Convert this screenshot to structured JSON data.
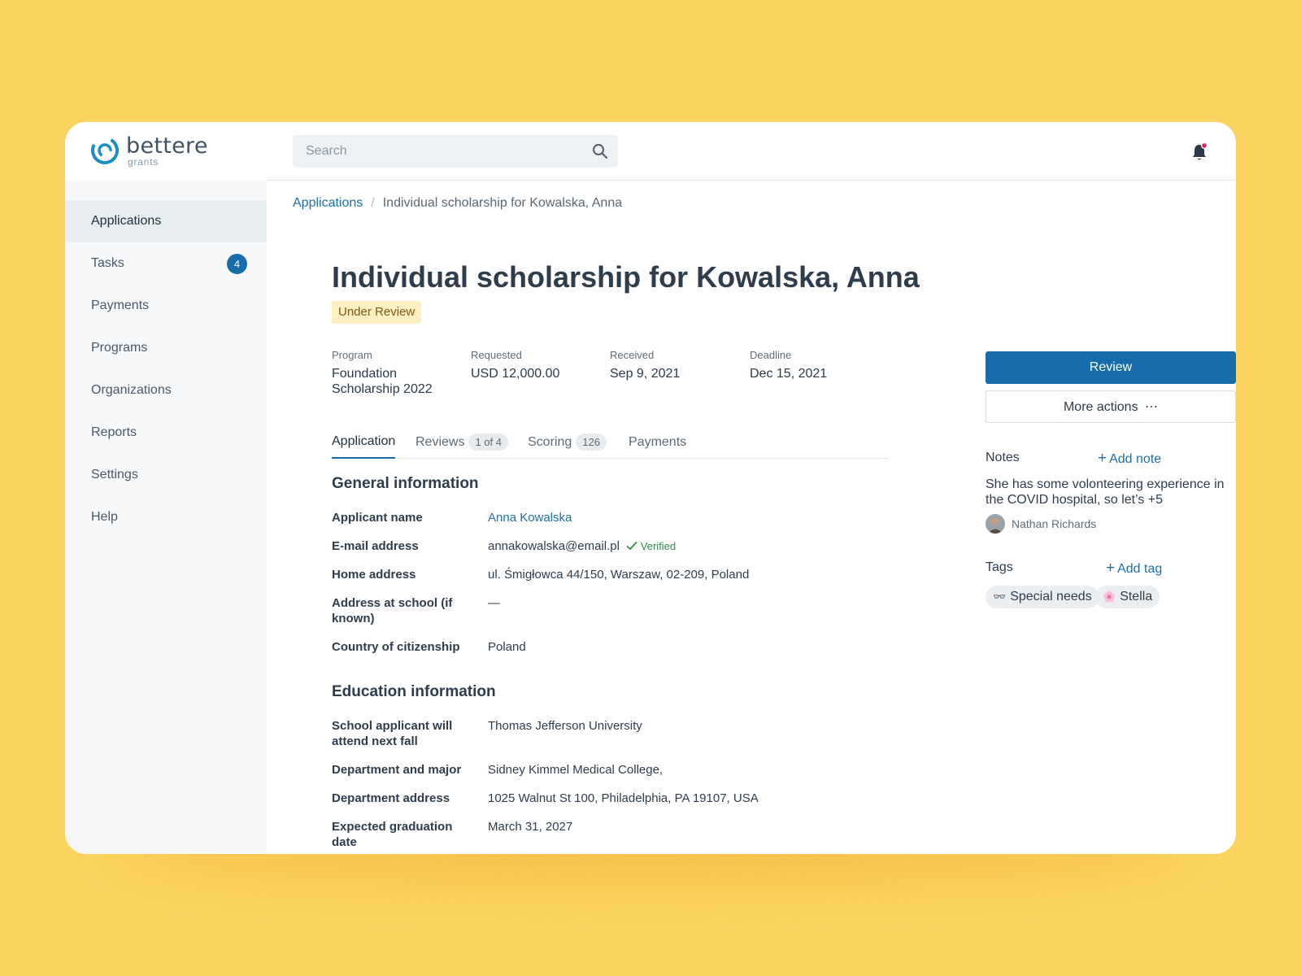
{
  "brand": {
    "name": "bettere",
    "tagline": "grants",
    "color": "#176cab"
  },
  "search": {
    "placeholder": "Search"
  },
  "sidebar": {
    "items": [
      {
        "label": "Applications",
        "active": true
      },
      {
        "label": "Tasks",
        "badge": "4"
      },
      {
        "label": "Payments"
      },
      {
        "label": "Programs"
      },
      {
        "label": "Organizations"
      },
      {
        "label": "Reports"
      },
      {
        "label": "Settings"
      },
      {
        "label": "Help"
      }
    ]
  },
  "breadcrumb": {
    "parent": "Applications",
    "separator": "/",
    "current": "Individual scholarship for Kowalska, Anna"
  },
  "header": {
    "title": "Individual scholarship for Kowalska, Anna",
    "status": "Under Review"
  },
  "meta": [
    {
      "label": "Program",
      "value": "Foundation Scholarship 2022"
    },
    {
      "label": "Requested",
      "value": "USD 12,000.00"
    },
    {
      "label": "Received",
      "value": "Sep 9, 2021"
    },
    {
      "label": "Deadline",
      "value": "Dec 15, 2021"
    }
  ],
  "tabs": [
    {
      "label": "Application",
      "active": true
    },
    {
      "label": "Reviews",
      "count": "1 of 4"
    },
    {
      "label": "Scoring",
      "count": "126"
    },
    {
      "label": "Payments"
    }
  ],
  "general": {
    "title": "General information",
    "fields": [
      {
        "label": "Applicant name",
        "value": "Anna Kowalska"
      },
      {
        "label": "E-mail address",
        "value": "annakowalska@email.pl",
        "verified": "Verified"
      },
      {
        "label": "Home address",
        "value": "ul. Śmigłowca 44/150, Warszaw, 02-209, Poland"
      },
      {
        "label": "Address at school (if known)",
        "value": "—"
      },
      {
        "label": "Country of citizenship",
        "value": "Poland"
      }
    ]
  },
  "education": {
    "title": "Education information",
    "fields": [
      {
        "label": "School applicant will attend next fall",
        "value": "Thomas Jefferson University"
      },
      {
        "label": "Department and major",
        "value": "Sidney Kimmel Medical College,"
      },
      {
        "label": "Department address",
        "value": "1025 Walnut St 100, Philadelphia, PA 19107, USA"
      },
      {
        "label": "Expected graduation date",
        "value": "March 31, 2027"
      }
    ]
  },
  "actions": {
    "review": "Review",
    "more": "More actions",
    "more_icon": "⋯"
  },
  "notes": {
    "title": "Notes",
    "add_label": "Add note",
    "text": "She has some volonteering experience in the COVID hospital, so let’s +5",
    "author": "Nathan Richards"
  },
  "tags": {
    "title": "Tags",
    "add_label": "Add tag",
    "items": [
      {
        "emoji": "👓",
        "label": "Special needs"
      },
      {
        "emoji": "🌸",
        "label": "Stella"
      }
    ]
  },
  "colors": {
    "background": "#fcd462",
    "accent": "#176cab",
    "status_bg": "#fdefc2",
    "notification": "#e0245e"
  }
}
